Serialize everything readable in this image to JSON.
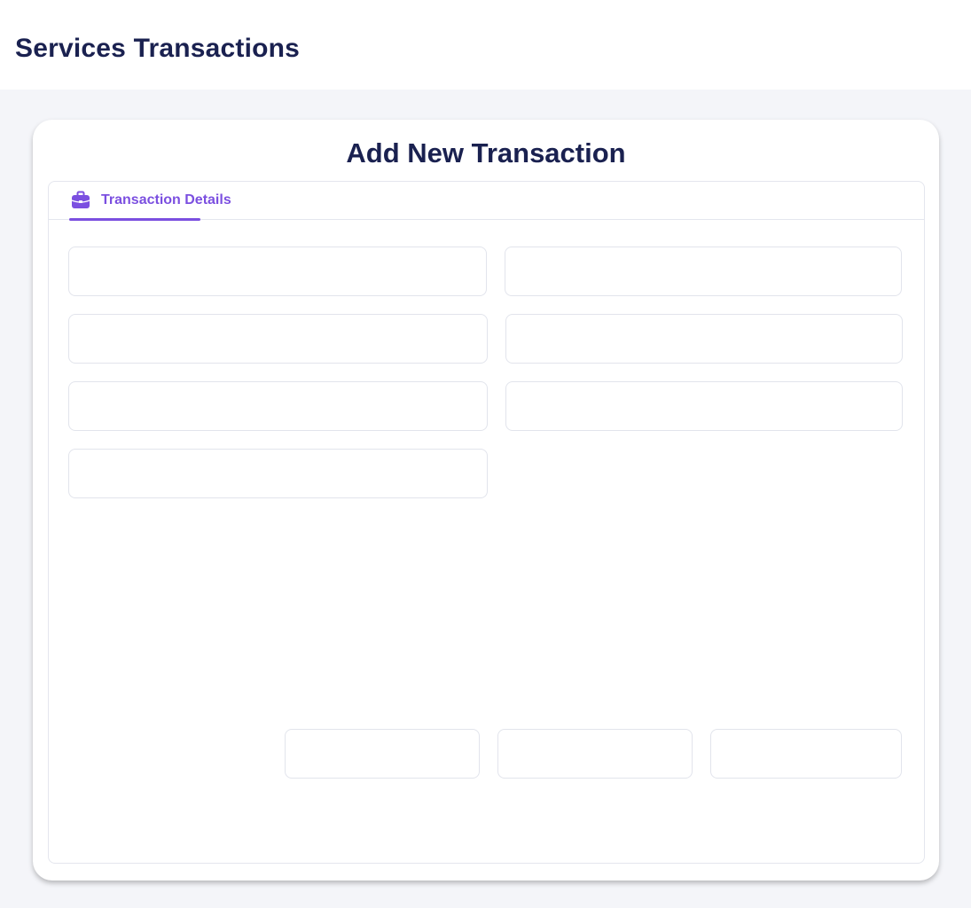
{
  "header": {
    "title": "Services Transactions"
  },
  "card": {
    "title": "Add New Transaction",
    "tabs": [
      {
        "label": "Transaction Details",
        "icon": "briefcase-icon",
        "active": true
      }
    ]
  },
  "form": {
    "fields": [
      {
        "value": "",
        "placeholder": ""
      },
      {
        "value": "",
        "placeholder": ""
      },
      {
        "value": "",
        "placeholder": ""
      },
      {
        "value": "",
        "placeholder": ""
      },
      {
        "value": "",
        "placeholder": ""
      },
      {
        "value": "",
        "placeholder": ""
      },
      {
        "value": "",
        "placeholder": ""
      }
    ],
    "bottom_fields": [
      {
        "value": "",
        "placeholder": ""
      },
      {
        "value": "",
        "placeholder": ""
      },
      {
        "value": "",
        "placeholder": ""
      }
    ]
  },
  "colors": {
    "accent": "#7b4fe0",
    "heading": "#1a2150",
    "background": "#f4f5f9",
    "border": "#e2e4ec"
  }
}
